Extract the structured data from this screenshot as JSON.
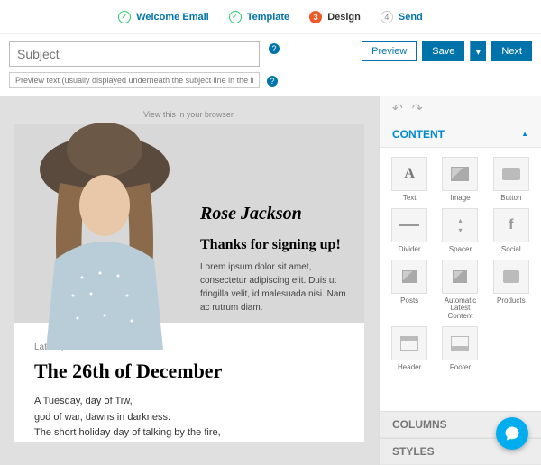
{
  "stepper": {
    "steps": [
      {
        "label": "Welcome Email",
        "state": "done"
      },
      {
        "label": "Template",
        "state": "done"
      },
      {
        "label": "Design",
        "state": "active",
        "num": "3"
      },
      {
        "label": "Send",
        "state": "pending",
        "num": "4"
      }
    ]
  },
  "toolbar": {
    "subject_placeholder": "Subject",
    "preview_placeholder": "Preview text (usually displayed underneath the subject line in the inbox)",
    "preview_btn": "Preview",
    "save_btn": "Save",
    "next_btn": "Next"
  },
  "canvas": {
    "browser_link": "View this in your browser.",
    "signature": "Rose Jackson",
    "thanks": "Thanks for signing up!",
    "lorem": "Lorem ipsum dolor sit amet, consectetur adipiscing elit. Duis ut fringilla velit, id malesuada nisi. Nam ac rutrum diam.",
    "article_tag": "Latest p",
    "article_title": "The 26th of December",
    "article_body1": "A Tuesday, day of Tiw,",
    "article_body2": "god of war, dawns in darkness.",
    "article_body3": "The short holiday day of talking by the fire,"
  },
  "sidebar": {
    "content_head": "CONTENT",
    "columns_head": "COLUMNS",
    "styles_head": "STYLES",
    "blocks": [
      {
        "label": "Text",
        "icon": "A"
      },
      {
        "label": "Image",
        "icon": "img"
      },
      {
        "label": "Button",
        "icon": "btn"
      },
      {
        "label": "Divider",
        "icon": "div"
      },
      {
        "label": "Spacer",
        "icon": "spc"
      },
      {
        "label": "Social",
        "icon": "soc"
      },
      {
        "label": "Posts",
        "icon": "pst"
      },
      {
        "label": "Automatic Latest Content",
        "icon": "alc"
      },
      {
        "label": "Products",
        "icon": "prd"
      },
      {
        "label": "Header",
        "icon": "hdr"
      },
      {
        "label": "Footer",
        "icon": "ftr"
      }
    ]
  }
}
